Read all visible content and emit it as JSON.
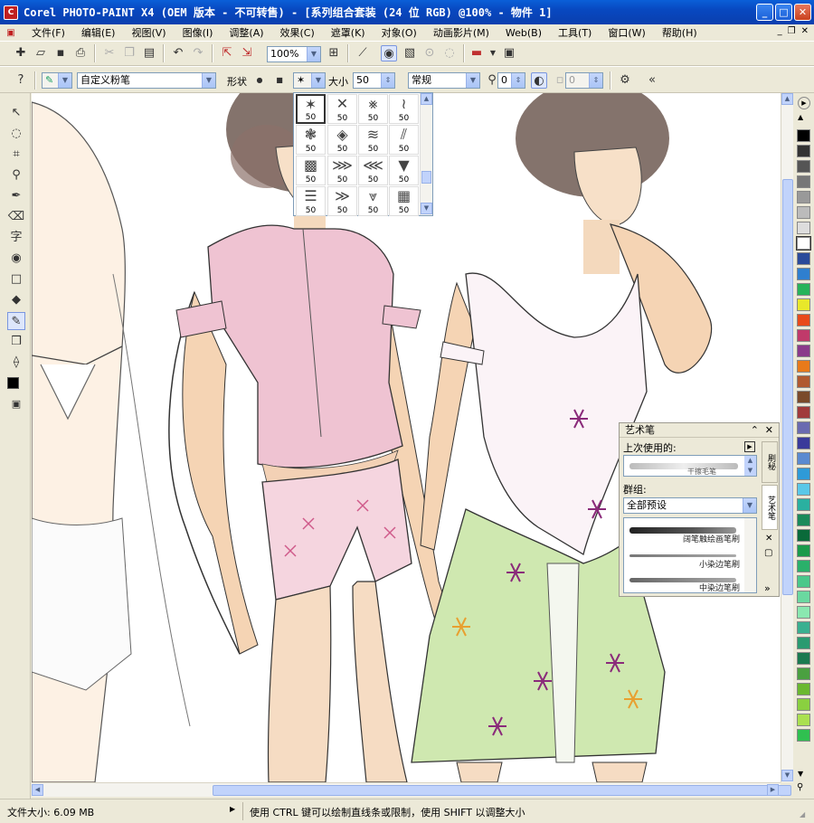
{
  "window": {
    "title": "Corel PHOTO-PAINT X4 (OEM 版本 - 不可转售) - [系列组合套装 (24 位 RGB) @100% - 物件 1]",
    "app_icon": "corel-icon",
    "controls": [
      "minimize",
      "maximize",
      "close"
    ]
  },
  "menu": [
    "文件(F)",
    "编辑(E)",
    "视图(V)",
    "图像(I)",
    "调整(A)",
    "效果(C)",
    "遮罩(K)",
    "对象(O)",
    "动画影片(M)",
    "Web(B)",
    "工具(T)",
    "窗口(W)",
    "帮助(H)"
  ],
  "standard_toolbar": {
    "zoom": "100%",
    "icons": [
      "new-icon",
      "open-icon",
      "save-icon",
      "print-icon",
      "cut-icon",
      "copy-icon",
      "paste-icon",
      "undo-icon",
      "redo-icon",
      "import-icon",
      "export-icon",
      "zoom-fit-icon",
      "stroke-icon",
      "mask-icon"
    ]
  },
  "property_bar": {
    "brush_preset": "自定义粉笔",
    "shape_label": "形状",
    "size_label": "大小",
    "size_value": "50",
    "merge_mode": "常规",
    "transparency_value": "0",
    "feather_value": "0"
  },
  "nib_picker": {
    "nibs": [
      {
        "glyph": "✶",
        "value": "50",
        "selected": true
      },
      {
        "glyph": "✕",
        "value": "50"
      },
      {
        "glyph": "⨳",
        "value": "50"
      },
      {
        "glyph": "≀",
        "value": "50"
      },
      {
        "glyph": "❃",
        "value": "50"
      },
      {
        "glyph": "◈",
        "value": "50"
      },
      {
        "glyph": "≋",
        "value": "50"
      },
      {
        "glyph": "⫽",
        "value": "50"
      },
      {
        "glyph": "▩",
        "value": "50"
      },
      {
        "glyph": "⋙",
        "value": "50"
      },
      {
        "glyph": "⋘",
        "value": "50"
      },
      {
        "glyph": "▼",
        "value": "50"
      },
      {
        "glyph": "☰",
        "value": "50"
      },
      {
        "glyph": "≫",
        "value": "50"
      },
      {
        "glyph": "⩔",
        "value": "50"
      },
      {
        "glyph": "▦",
        "value": "50"
      }
    ]
  },
  "docker": {
    "title": "艺术笔",
    "recent_label": "上次使用的:",
    "recent_item": "干擦毛笔",
    "group_label": "群组:",
    "group_value": "全部预设",
    "strokes": [
      "阔笔触绘画笔刷",
      "小染边笔刷",
      "中染边笔刷"
    ],
    "tabs": [
      "刷秘",
      "艺术笔"
    ]
  },
  "status": {
    "file_size": "文件大小: 6.09 MB",
    "hint": "使用 CTRL 键可以绘制直线条或限制，使用 SHIFT 以调整大小"
  },
  "palette_colors": [
    "#000000",
    "#333333",
    "#555555",
    "#777777",
    "#999999",
    "#bbbbbb",
    "#dddddd",
    "#ffffff",
    "#2a4a9a",
    "#2f7fcf",
    "#27b35a",
    "#e8e82a",
    "#e84a1a",
    "#c03a6a",
    "#8a3a8a",
    "#e87a1a",
    "#b05a30",
    "#7a4a2a",
    "#a03a3a",
    "#6a6ab0",
    "#3a3a9a",
    "#5a8ad0",
    "#2e9ad8",
    "#5ac8e8",
    "#2ab0a0",
    "#1a8a5a",
    "#0a6a3a",
    "#1a9a4a",
    "#2ab06a",
    "#4ac88a",
    "#6ad8a0",
    "#8ae8b0",
    "#3ab090",
    "#2a9a70",
    "#1a7a50",
    "#4aa040",
    "#6ab830",
    "#8ad040",
    "#aae050",
    "#30c050"
  ],
  "palette_selected": "#ffffff",
  "foreground_color": "#000000",
  "background_color": "#ffffff"
}
